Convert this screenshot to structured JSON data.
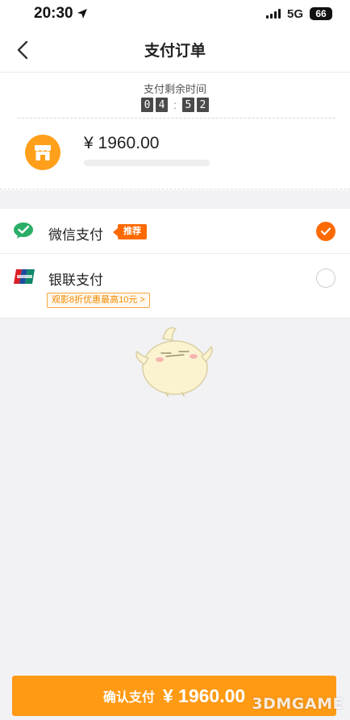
{
  "status_bar": {
    "time": "20:30",
    "network": "5G",
    "battery": "66"
  },
  "header": {
    "title": "支付订单"
  },
  "countdown": {
    "label": "支付剩余时间",
    "digits": [
      "0",
      "4",
      "5",
      "2"
    ],
    "separator": ":"
  },
  "order": {
    "amount": "¥ 1960.00",
    "store_icon": "store-icon"
  },
  "payment_methods": [
    {
      "name": "微信支付",
      "tag": "推荐",
      "selected": true,
      "icon": "wechat-pay-icon"
    },
    {
      "name": "银联支付",
      "promo": "观影8折优惠最高10元 >",
      "selected": false,
      "icon": "unionpay-icon"
    }
  ],
  "confirm": {
    "label": "确认支付",
    "price": "¥ 1960.00"
  },
  "watermark": "3DMGAME",
  "colors": {
    "accent": "#ff9a14",
    "tag": "#ff6a00",
    "wechat": "#2aae67"
  }
}
